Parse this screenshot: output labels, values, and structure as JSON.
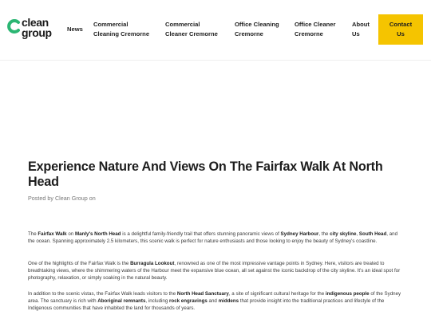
{
  "brand": {
    "line1": "clean",
    "line2": "group",
    "accent": "#2bb673"
  },
  "nav": {
    "news": "News",
    "commercial_cleaning_1": "Commercial",
    "commercial_cleaning_2": "Cleaning Cremorne",
    "commercial_cleaner_1": "Commercial",
    "commercial_cleaner_2": "Cleaner Cremorne",
    "office_cleaning_1": "Office Cleaning",
    "office_cleaning_2": "Cremorne",
    "office_cleaner_1": "Office Cleaner",
    "office_cleaner_2": "Cremorne",
    "about_1": "About",
    "about_2": "Us",
    "contact_1": "Contact",
    "contact_2": "Us",
    "contact_color": "#f5c400"
  },
  "article": {
    "title": "Experience Nature And Views On The Fairfax Walk At North Head",
    "meta": "Posted by Clean Group on",
    "p1": {
      "t1": "The ",
      "b1": "Fairfax Walk",
      "t2": " on ",
      "b2": "Manly's North Head",
      "t3": " is a delightful family-friendly trail that offers stunning panoramic views of ",
      "b3": "Sydney Harbour",
      "t4": ", the ",
      "b4": "city skyline",
      "t5": ", ",
      "b5": "South Head",
      "t6": ", and the ocean. Spanning approximately 2.5 kilometers, this scenic walk is perfect for nature enthusiasts and those looking to enjoy the beauty of Sydney's coastline."
    },
    "p2": {
      "t1": "One of the highlights of the Fairfax Walk is the ",
      "b1": "Burragula Lookout",
      "t2": ", renowned as one of the most impressive vantage points in Sydney. Here, visitors are treated to breathtaking views, where the shimmering waters of the Harbour meet the expansive blue ocean, all set against the iconic backdrop of the city skyline. It's an ideal spot for photography, relaxation, or simply soaking in the natural beauty."
    },
    "p3": {
      "t1": "In addition to the scenic vistas, the Fairfax Walk leads visitors to the ",
      "b1": "North Head Sanctuary",
      "t2": ", a site of significant cultural heritage for the ",
      "b2": "indigenous people",
      "t3": " of the Sydney area. The sanctuary is rich with ",
      "b3": "Aboriginal remnants",
      "t4": ", including ",
      "b4": "rock engravings",
      "t5": " and ",
      "b5": "middens",
      "t6": " that provide insight into the traditional practices and lifestyle of the Indigenous communities that have inhabited the land for thousands of years."
    }
  }
}
